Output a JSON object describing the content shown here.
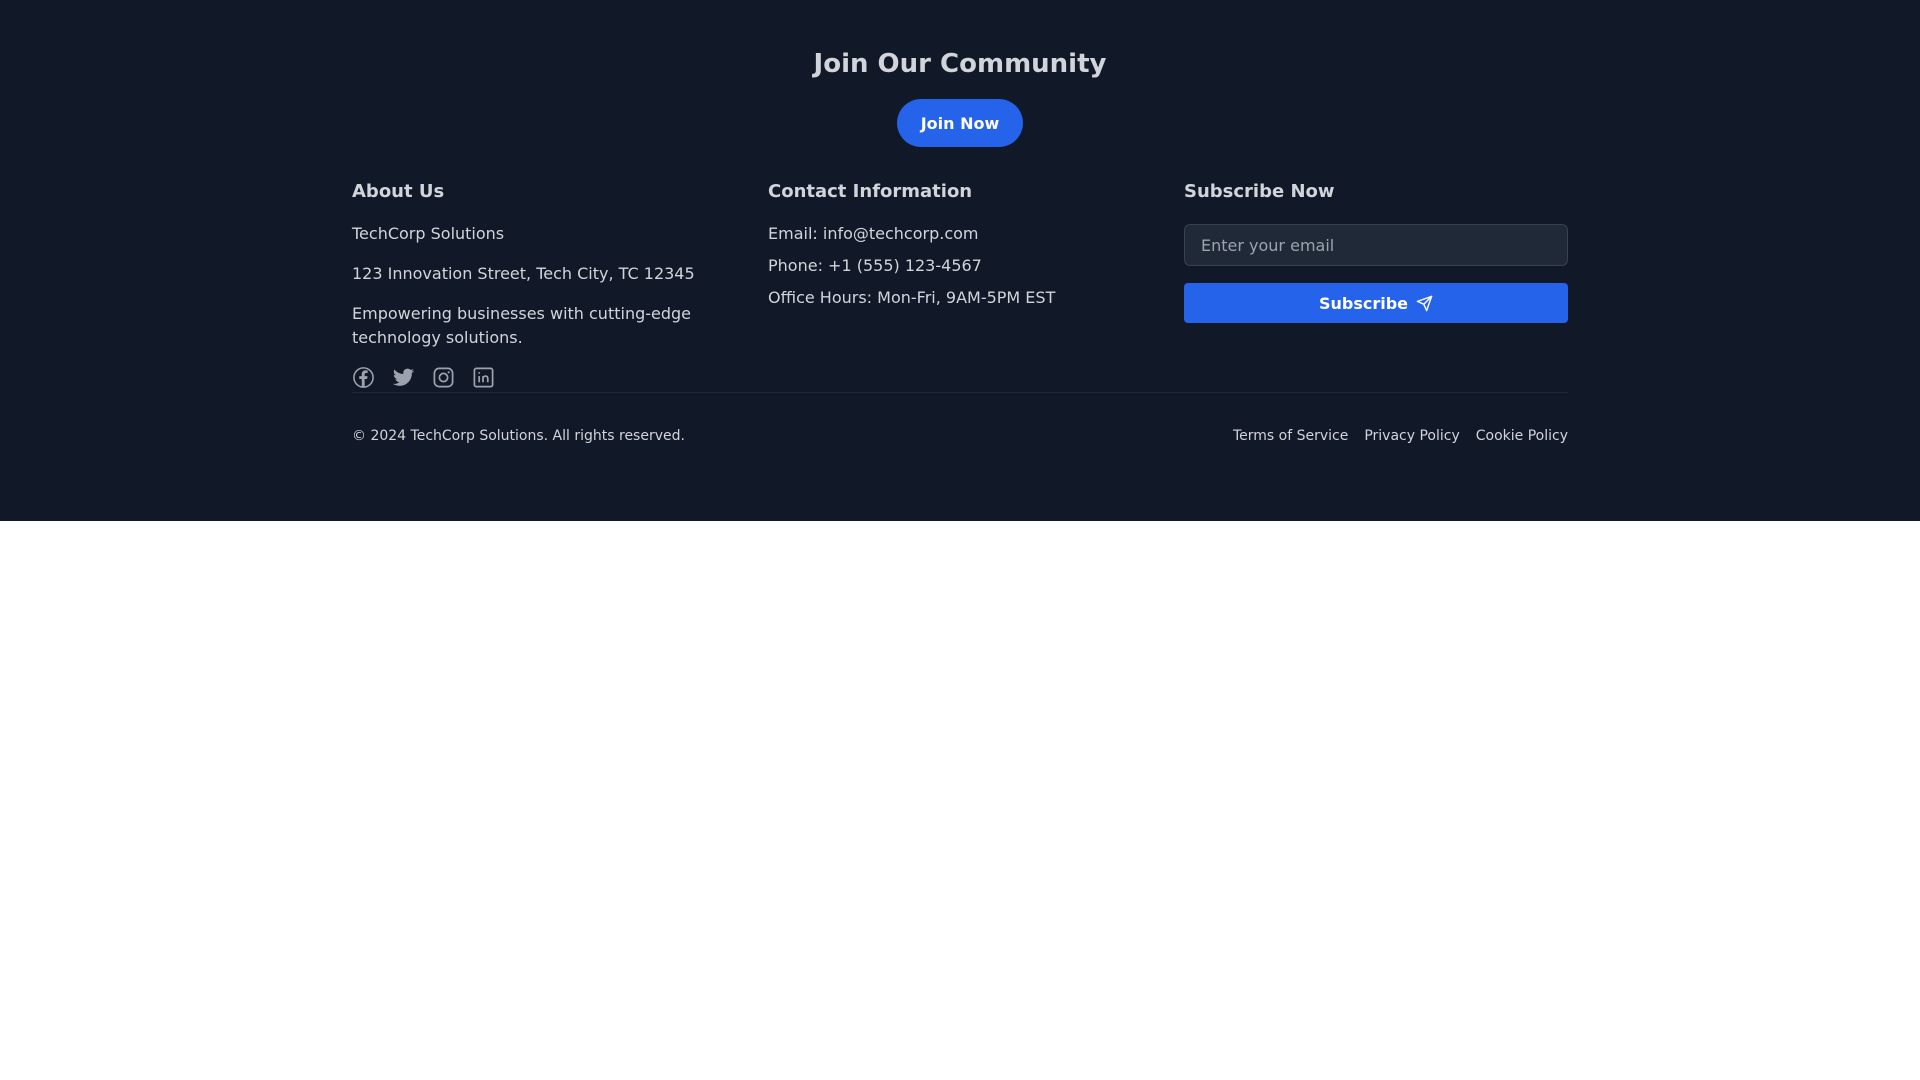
{
  "cta": {
    "title": "Join Our Community",
    "button_label": "Join Now"
  },
  "about": {
    "heading": "About Us",
    "company": "TechCorp Solutions",
    "address": "123 Innovation Street, Tech City, TC 12345",
    "tagline": "Empowering businesses with cutting-edge technology solutions.",
    "social_icons": [
      "facebook-icon",
      "twitter-icon",
      "instagram-icon",
      "linkedin-icon"
    ]
  },
  "contact": {
    "heading": "Contact Information",
    "email": "Email: info@techcorp.com",
    "phone": "Phone: +1 (555) 123-4567",
    "hours": "Office Hours: Mon-Fri, 9AM-5PM EST"
  },
  "subscribe": {
    "heading": "Subscribe Now",
    "email_placeholder": "Enter your email",
    "email_value": "",
    "button_label": "Subscribe",
    "button_icon": "send-icon"
  },
  "bottom": {
    "copyright": "© 2024 TechCorp Solutions. All rights reserved.",
    "links": [
      "Terms of Service",
      "Privacy Policy",
      "Cookie Policy"
    ]
  },
  "colors": {
    "footer_background": "#111827",
    "accent": "#2563eb",
    "text": "#d1d5db",
    "icon": "#9ca3af",
    "input_background": "#1f2937"
  }
}
